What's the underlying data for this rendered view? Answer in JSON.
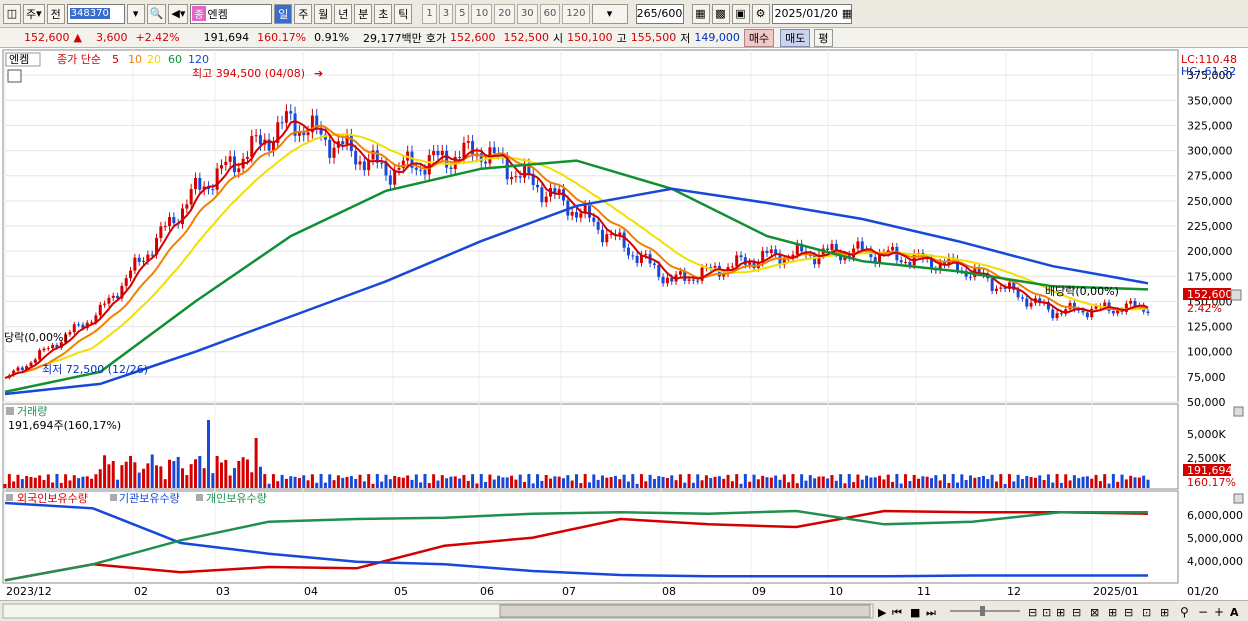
{
  "toolbar": {
    "period_selected": "주",
    "prev_label": "전",
    "stock_code": "348370",
    "market_badge": "종",
    "stock_name": "엔켐",
    "period_buttons": [
      "일",
      "주",
      "월",
      "년",
      "분",
      "초",
      "틱"
    ],
    "interval_buttons": [
      "1",
      "3",
      "5",
      "10",
      "20",
      "30",
      "60",
      "120"
    ],
    "count": "265",
    "count_max": "/600",
    "date": "2025/01/20"
  },
  "info": {
    "price": "152,600",
    "change_arrow": "▲",
    "change": "3,600",
    "change_pct": "+2.42%",
    "volume": "191,694",
    "volume_ratio": "160.17%",
    "turnover": "0.91%",
    "amount": "29,177백만",
    "ask_label": "호가",
    "ask1": "152,600",
    "ask2": "152,500",
    "open_label": "시",
    "open": "150,100",
    "high_label": "고",
    "high": "155,500",
    "low_label": "저",
    "low": "149,000",
    "buy": "매수",
    "sell": "매도",
    "eval": "평"
  },
  "price_panel": {
    "title": "엔켐",
    "legend_prefix": "종가 단순",
    "ma_labels": [
      "5",
      "10",
      "20",
      "60",
      "120"
    ],
    "ma_colors": [
      "#d40000",
      "#f08000",
      "#f0e000",
      "#109030",
      "#1848d8"
    ],
    "high_annotation": "최고 394,500 (04/08)",
    "low_annotation": "최저 72,500 (12/26)",
    "left_annotation": "당락(0,00%)",
    "right_annotation": "배당락(0,00%)",
    "lc": "LC:110.48",
    "hc": "HC:-61.32",
    "last_price_tag": "152,600",
    "last_pct_tag": "2.42%",
    "yticks": [
      "375,000",
      "350,000",
      "325,000",
      "300,000",
      "275,000",
      "250,000",
      "225,000",
      "200,000",
      "175,000",
      "150,000",
      "125,000",
      "100,000",
      "75,000",
      "50,000"
    ]
  },
  "volume_panel": {
    "title": "거래량",
    "subtitle": "191,694주(160,17%)",
    "yticks": [
      "5,000K",
      "2,500K"
    ],
    "last_tag": "191,694",
    "last_pct": "160.17%"
  },
  "holding_panel": {
    "legend": [
      "외국인보유수량",
      "기관보유수량",
      "개인보유수량"
    ],
    "colors": [
      "#d40000",
      "#1848d8",
      "#209050"
    ],
    "yticks": [
      "6,000,000",
      "5,000,000",
      "4,000,000"
    ]
  },
  "xaxis": {
    "labels": [
      "2023/12",
      "02",
      "03",
      "04",
      "05",
      "06",
      "07",
      "08",
      "09",
      "10",
      "11",
      "12",
      "2025/01"
    ],
    "right_label": "01/20"
  },
  "chart_data": {
    "type": "line",
    "title": "엔켐",
    "x": [
      "2023/12",
      "02",
      "03",
      "04",
      "05",
      "06",
      "07",
      "08",
      "09",
      "10",
      "11",
      "12",
      "2025/01"
    ],
    "series": [
      {
        "name": "5",
        "values": [
          72500,
          140000,
          260000,
          330000,
          280000,
          300000,
          240000,
          170000,
          195000,
          200000,
          185000,
          140000,
          145000
        ]
      },
      {
        "name": "60",
        "values": [
          60000,
          80000,
          150000,
          215000,
          260000,
          282000,
          290000,
          262000,
          215000,
          190000,
          180000,
          165000,
          162000
        ]
      },
      {
        "name": "120",
        "values": [
          58000,
          68000,
          100000,
          135000,
          170000,
          210000,
          245000,
          262000,
          248000,
          232000,
          210000,
          185000,
          168000
        ]
      }
    ],
    "ylim": [
      50000,
      400000
    ],
    "high": 394500,
    "low": 72500,
    "last": 152600
  }
}
